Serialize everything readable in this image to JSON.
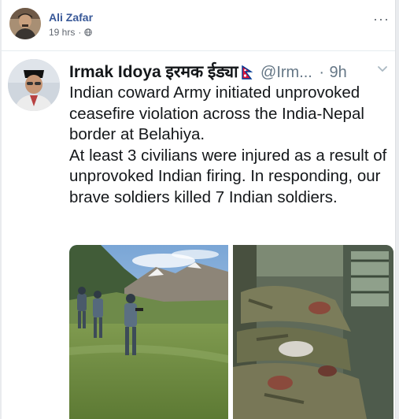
{
  "post": {
    "author": "Ali Zafar",
    "time": "19 hrs",
    "more_label": "···",
    "privacy_icon": "globe-icon"
  },
  "tweet": {
    "name": "Irmak Idoya इरमक ईड्या",
    "handle": "@Irm...",
    "separator": "·",
    "time": "9h",
    "flag_icon": "nepal-flag-icon",
    "paragraphs": [
      "Indian coward Army initiated unprovoked ceasefire violation across the India-Nepal border at Belahiya.",
      "At least 3 civilians were injured as a result of unprovoked Indian firing. In responding, our brave soldiers killed 7 Indian soldiers."
    ]
  },
  "colors": {
    "fb_link": "#385898",
    "tweet_text": "#14171a",
    "tweet_muted": "#657786",
    "nepal_red": "#dc143c",
    "nepal_blue": "#003893"
  }
}
